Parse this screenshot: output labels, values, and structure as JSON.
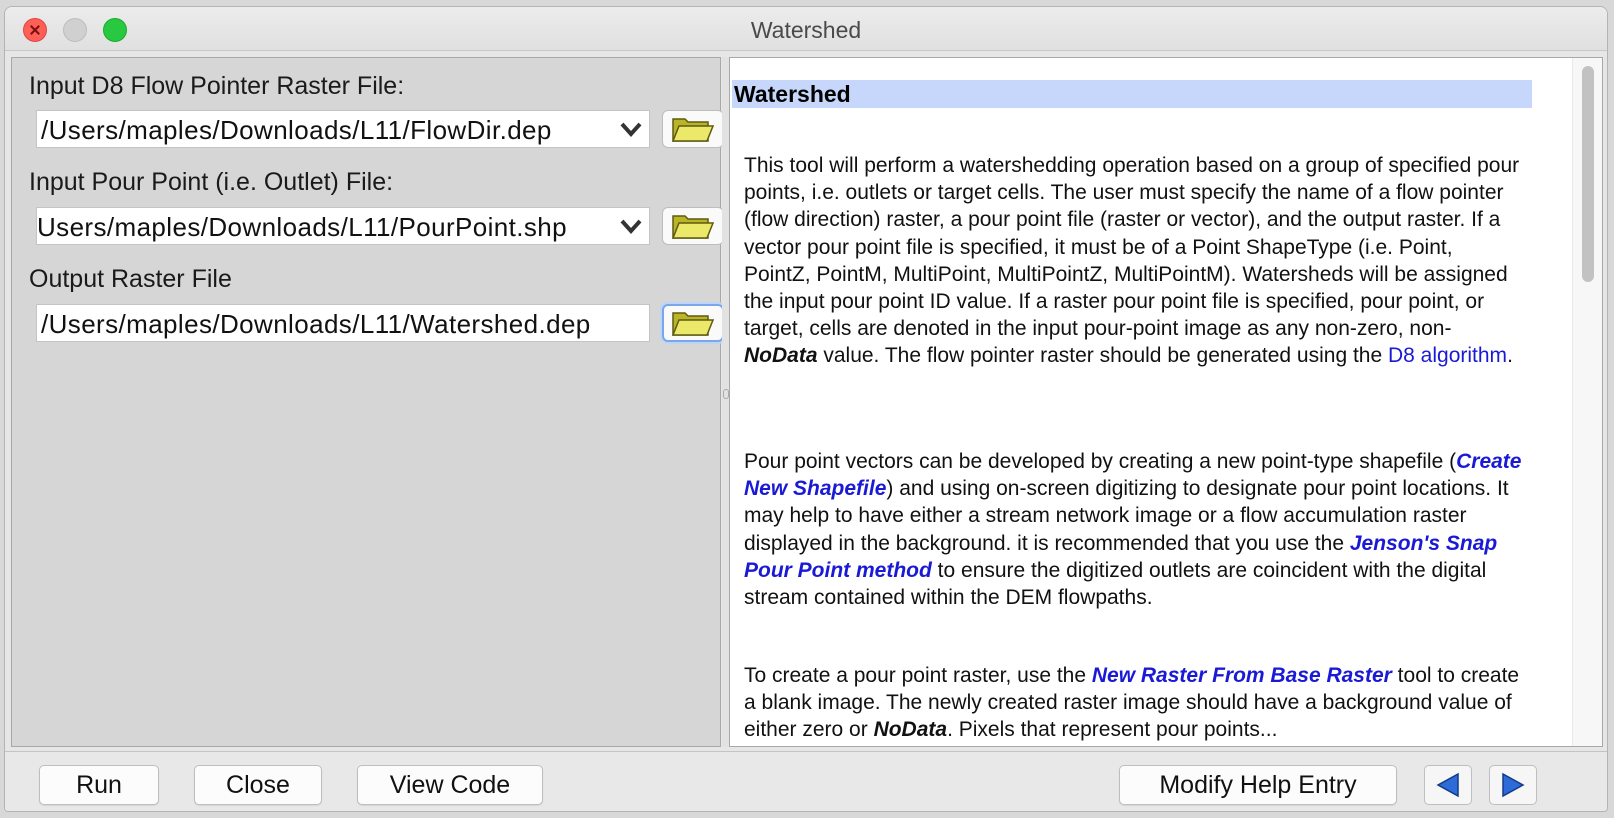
{
  "window": {
    "title": "Watershed"
  },
  "form": {
    "fields": [
      {
        "label": "Input D8 Flow Pointer Raster File:",
        "value": "/Users/maples/Downloads/L11/FlowDir.dep"
      },
      {
        "label": "Input Pour Point (i.e. Outlet) File:",
        "value": "Users/maples/Downloads/L11/PourPoint.shp"
      },
      {
        "label": "Output Raster File",
        "value": "/Users/maples/Downloads/L11/Watershed.dep"
      }
    ]
  },
  "help": {
    "heading": "Watershed",
    "p1": {
      "a": "This tool will perform a watershedding operation based on a group of specified pour points, i.e. outlets or target cells. The user must specify the name of a flow pointer (flow direction) raster, a pour point file (raster or vector), and the output raster. If a vector pour point file is specified, it must be of a Point ShapeType (i.e. Point, PointZ, PointM, MultiPoint, MultiPointZ, MultiPointM). Watersheds will be assigned the input pour point ID value. If a raster pour point file is specified, pour point, or target, cells are denoted in the input pour-point image as any non-zero, non-",
      "b": "NoData",
      "c": " value. The flow pointer raster should be generated using the ",
      "link": "D8 algorithm",
      "d": "."
    },
    "p2": {
      "a": "Pour point vectors can be developed by creating a new point-type shapefile (",
      "link1": "Create New Shapefile",
      "b": ") and using on-screen digitizing to designate pour point locations. It may help to have either a stream network image or a flow accumulation raster displayed in the background. it is recommended that you use the ",
      "link2": "Jenson's Snap Pour Point method",
      "c": " to ensure the digitized outlets are coincident with the digital stream contained within the DEM flowpaths."
    },
    "p3": {
      "a": "To create a pour point raster, use the ",
      "link": "New Raster From Base Raster",
      "b": " tool to create a blank image. The newly created raster image should have a background value of either zero or ",
      "c": "NoData",
      "d": ". Pixels that represent pour points..."
    }
  },
  "buttons": {
    "run": "Run",
    "close": "Close",
    "view_code": "View Code",
    "modify_help": "Modify Help Entry"
  },
  "icons": {
    "folder": "folder-open-icon",
    "chevron": "chevron-down-icon",
    "back": "arrow-left-icon",
    "forward": "arrow-right-icon"
  },
  "colors": {
    "link": "#1a1ad6",
    "heading_bg": "#c6d7fb",
    "close_light": "#fe5f57",
    "zoom_light": "#28c840"
  }
}
